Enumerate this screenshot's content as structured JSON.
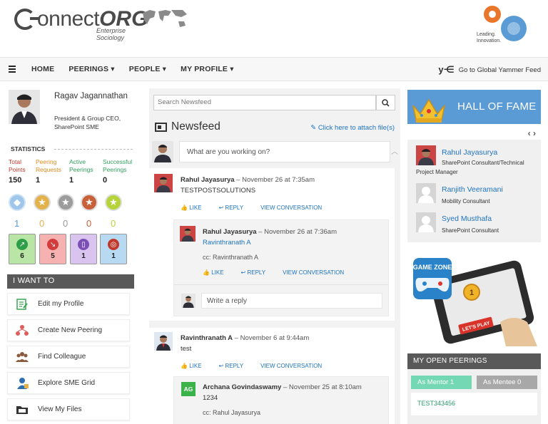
{
  "header": {
    "logo_text": "onnect",
    "logo_org": "ORG",
    "logo_sub": "Enterprise Sociology",
    "corp_tagline": "Leading.\nInnovation."
  },
  "nav": {
    "items": [
      "HOME",
      "PEERINGS ▾",
      "PEOPLE ▾",
      "MY PROFILE ▾"
    ],
    "yammer_icon": "y⋲",
    "yammer_link": "Go to Global Yammer Feed"
  },
  "profile": {
    "name": "Ragav Jagannathan",
    "title": "President & Group CEO, SharePoint SME"
  },
  "statistics": {
    "heading": "STATISTICS",
    "cols": [
      {
        "label": "Total Points",
        "value": "150",
        "color": "#c0392b"
      },
      {
        "label": "Peering Requests",
        "value": "1",
        "color": "#e08a1e"
      },
      {
        "label": "Active Peerings",
        "value": "1",
        "color": "#2e9e5b"
      },
      {
        "label": "Successful Peerings",
        "value": "0",
        "color": "#2e9e5b"
      }
    ],
    "badges": [
      {
        "icon": "diamond-badge-icon",
        "count": "1",
        "color": "#5b9bd5"
      },
      {
        "icon": "gold-star-badge-icon",
        "count": "0",
        "color": "#e3b24a"
      },
      {
        "icon": "silver-star-badge-icon",
        "count": "0",
        "color": "#9c9c9c"
      },
      {
        "icon": "bronze-star-badge-icon",
        "count": "0",
        "color": "#c8613a"
      },
      {
        "icon": "green-star-badge-icon",
        "count": "0",
        "color": "#b6d33a"
      }
    ],
    "tiles": [
      {
        "icon": "arrow-up-right-icon",
        "count": "6",
        "bg": "#b9e6a6",
        "dot": "#2e9e48"
      },
      {
        "icon": "arrow-down-right-icon",
        "count": "5",
        "bg": "#f6b1b1",
        "dot": "#d23c3c"
      },
      {
        "icon": "document-icon",
        "count": "1",
        "bg": "#d9c4ef",
        "dot": "#7b4fb5"
      },
      {
        "icon": "target-icon",
        "count": "1",
        "bg": "#b8d9f2",
        "dot": "#c0392b"
      }
    ]
  },
  "iwant": {
    "heading": "I WANT TO",
    "items": [
      {
        "label": "Edit my Profile",
        "icon": "edit-profile-icon"
      },
      {
        "label": "Create New Peering",
        "icon": "create-peering-icon"
      },
      {
        "label": "Find Colleague",
        "icon": "find-colleague-icon"
      },
      {
        "label": "Explore SME Grid",
        "icon": "sme-grid-icon"
      },
      {
        "label": "View My Files",
        "icon": "files-icon"
      }
    ]
  },
  "newsfeed": {
    "search_placeholder": "Search Newsfeed",
    "title": "Newsfeed",
    "attach_link": "✎ Click here to attach file(s)",
    "composer_placeholder": "What are you working on?",
    "action_like": "LIKE",
    "action_reply": "REPLY",
    "action_view": "VIEW CONVERSATION",
    "write_reply_placeholder": "Write a reply",
    "posts": [
      {
        "author": "Rahul Jayasurya",
        "when": " – November 26 at 7:35am",
        "body": "TESTPOSTSOLUTIONS",
        "reply": {
          "author": "Rahul Jayasurya",
          "when": " – November 26 at 7:36am",
          "mention": "Ravinthranath A",
          "cc": "cc: Ravinthranath A"
        }
      },
      {
        "author": "Ravinthranath A",
        "when": " – November 6 at 9:44am",
        "body": "test",
        "reply": {
          "author": "Archana Govindaswamy",
          "initials": "AG",
          "when": " – November 25 at 8:10am",
          "body": "1234",
          "cc": "cc: Rahul Jayasurya"
        }
      }
    ]
  },
  "hall_of_fame": {
    "title": "HALL OF FAME",
    "nav": "‹ ›",
    "people": [
      {
        "name": "Rahul Jayasurya",
        "role": "SharePoint Consultant/Technical Project Manager"
      },
      {
        "name": "Ranjith Veeramani",
        "role": "Mobility Consultant"
      },
      {
        "name": "Syed Musthafa",
        "role": "SharePoint Consultant"
      }
    ]
  },
  "game_zone": {
    "logo": "GAME ZONE",
    "button": "LET'S PLAY",
    "coin": "1"
  },
  "open_peerings": {
    "heading": "MY OPEN PEERINGS",
    "tab_mentor": "As Mentor 1",
    "tab_mentee": "As Mentee 0",
    "items": [
      "TEST343456"
    ]
  },
  "colors": {
    "accent_blue": "#5b9bd5",
    "link_blue": "#1e73be",
    "dark_header": "#595959",
    "mentor_green": "#74d8b4"
  }
}
